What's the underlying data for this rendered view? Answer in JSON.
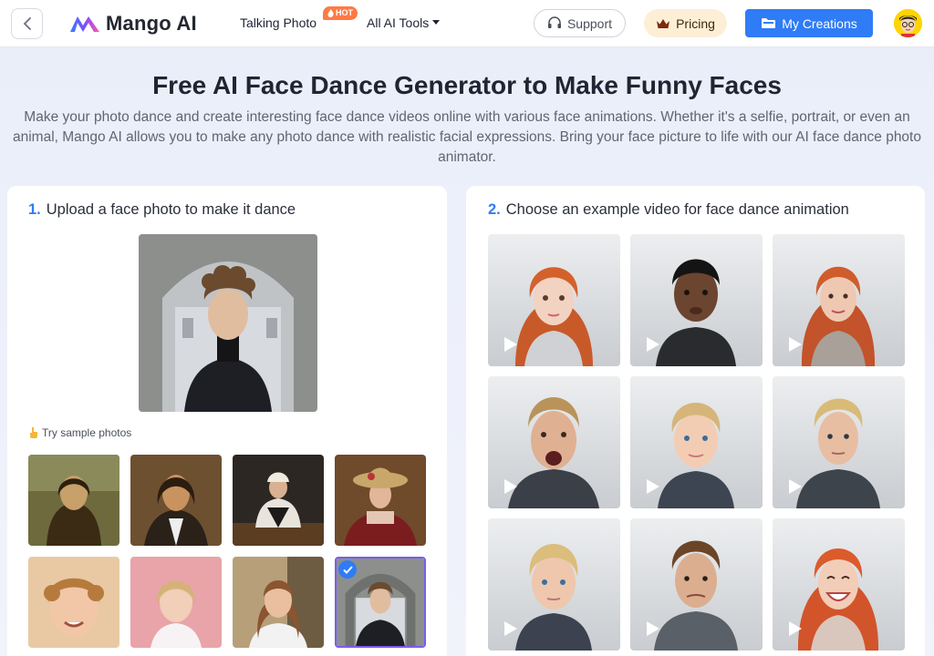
{
  "header": {
    "brand": "Mango AI",
    "nav_talking_photo": "Talking Photo",
    "hot_badge": "HOT",
    "nav_all_tools": "All AI Tools",
    "support": "Support",
    "pricing": "Pricing",
    "my_creations": "My Creations"
  },
  "hero": {
    "title": "Free AI Face Dance Generator to Make Funny Faces",
    "subtitle": "Make your photo dance and create interesting face dance videos online with various face animations. Whether it's a selfie, portrait, or even an animal, Mango AI allows you to make any photo dance with realistic facial expressions. Bring your face picture to life with our AI face dance photo animator."
  },
  "step1": {
    "number": "1.",
    "label": "Upload a face photo to make it dance",
    "try_samples": "Try sample photos",
    "samples": [
      {
        "name": "mona-lisa"
      },
      {
        "name": "long-haired-man-portrait"
      },
      {
        "name": "renaissance-man-at-table"
      },
      {
        "name": "woman-with-hat"
      },
      {
        "name": "curly-child"
      },
      {
        "name": "toddler-girl"
      },
      {
        "name": "young-woman"
      },
      {
        "name": "curly-young-man",
        "selected": true
      }
    ]
  },
  "step2": {
    "number": "2.",
    "label": "Choose an example video for face dance animation",
    "videos": [
      {
        "name": "red-hair-girl"
      },
      {
        "name": "dark-skin-man"
      },
      {
        "name": "red-hair-woman"
      },
      {
        "name": "shouting-blond-man"
      },
      {
        "name": "blond-boy"
      },
      {
        "name": "blond-young-man"
      },
      {
        "name": "blond-kid-boy"
      },
      {
        "name": "brunette-man"
      },
      {
        "name": "laughing-red-hair-woman"
      }
    ]
  },
  "colors": {
    "accent": "#2f7cf6",
    "hot": "#ff7a45",
    "pricing_bg": "#fdeed6",
    "selected_border": "#7b5cf0"
  }
}
